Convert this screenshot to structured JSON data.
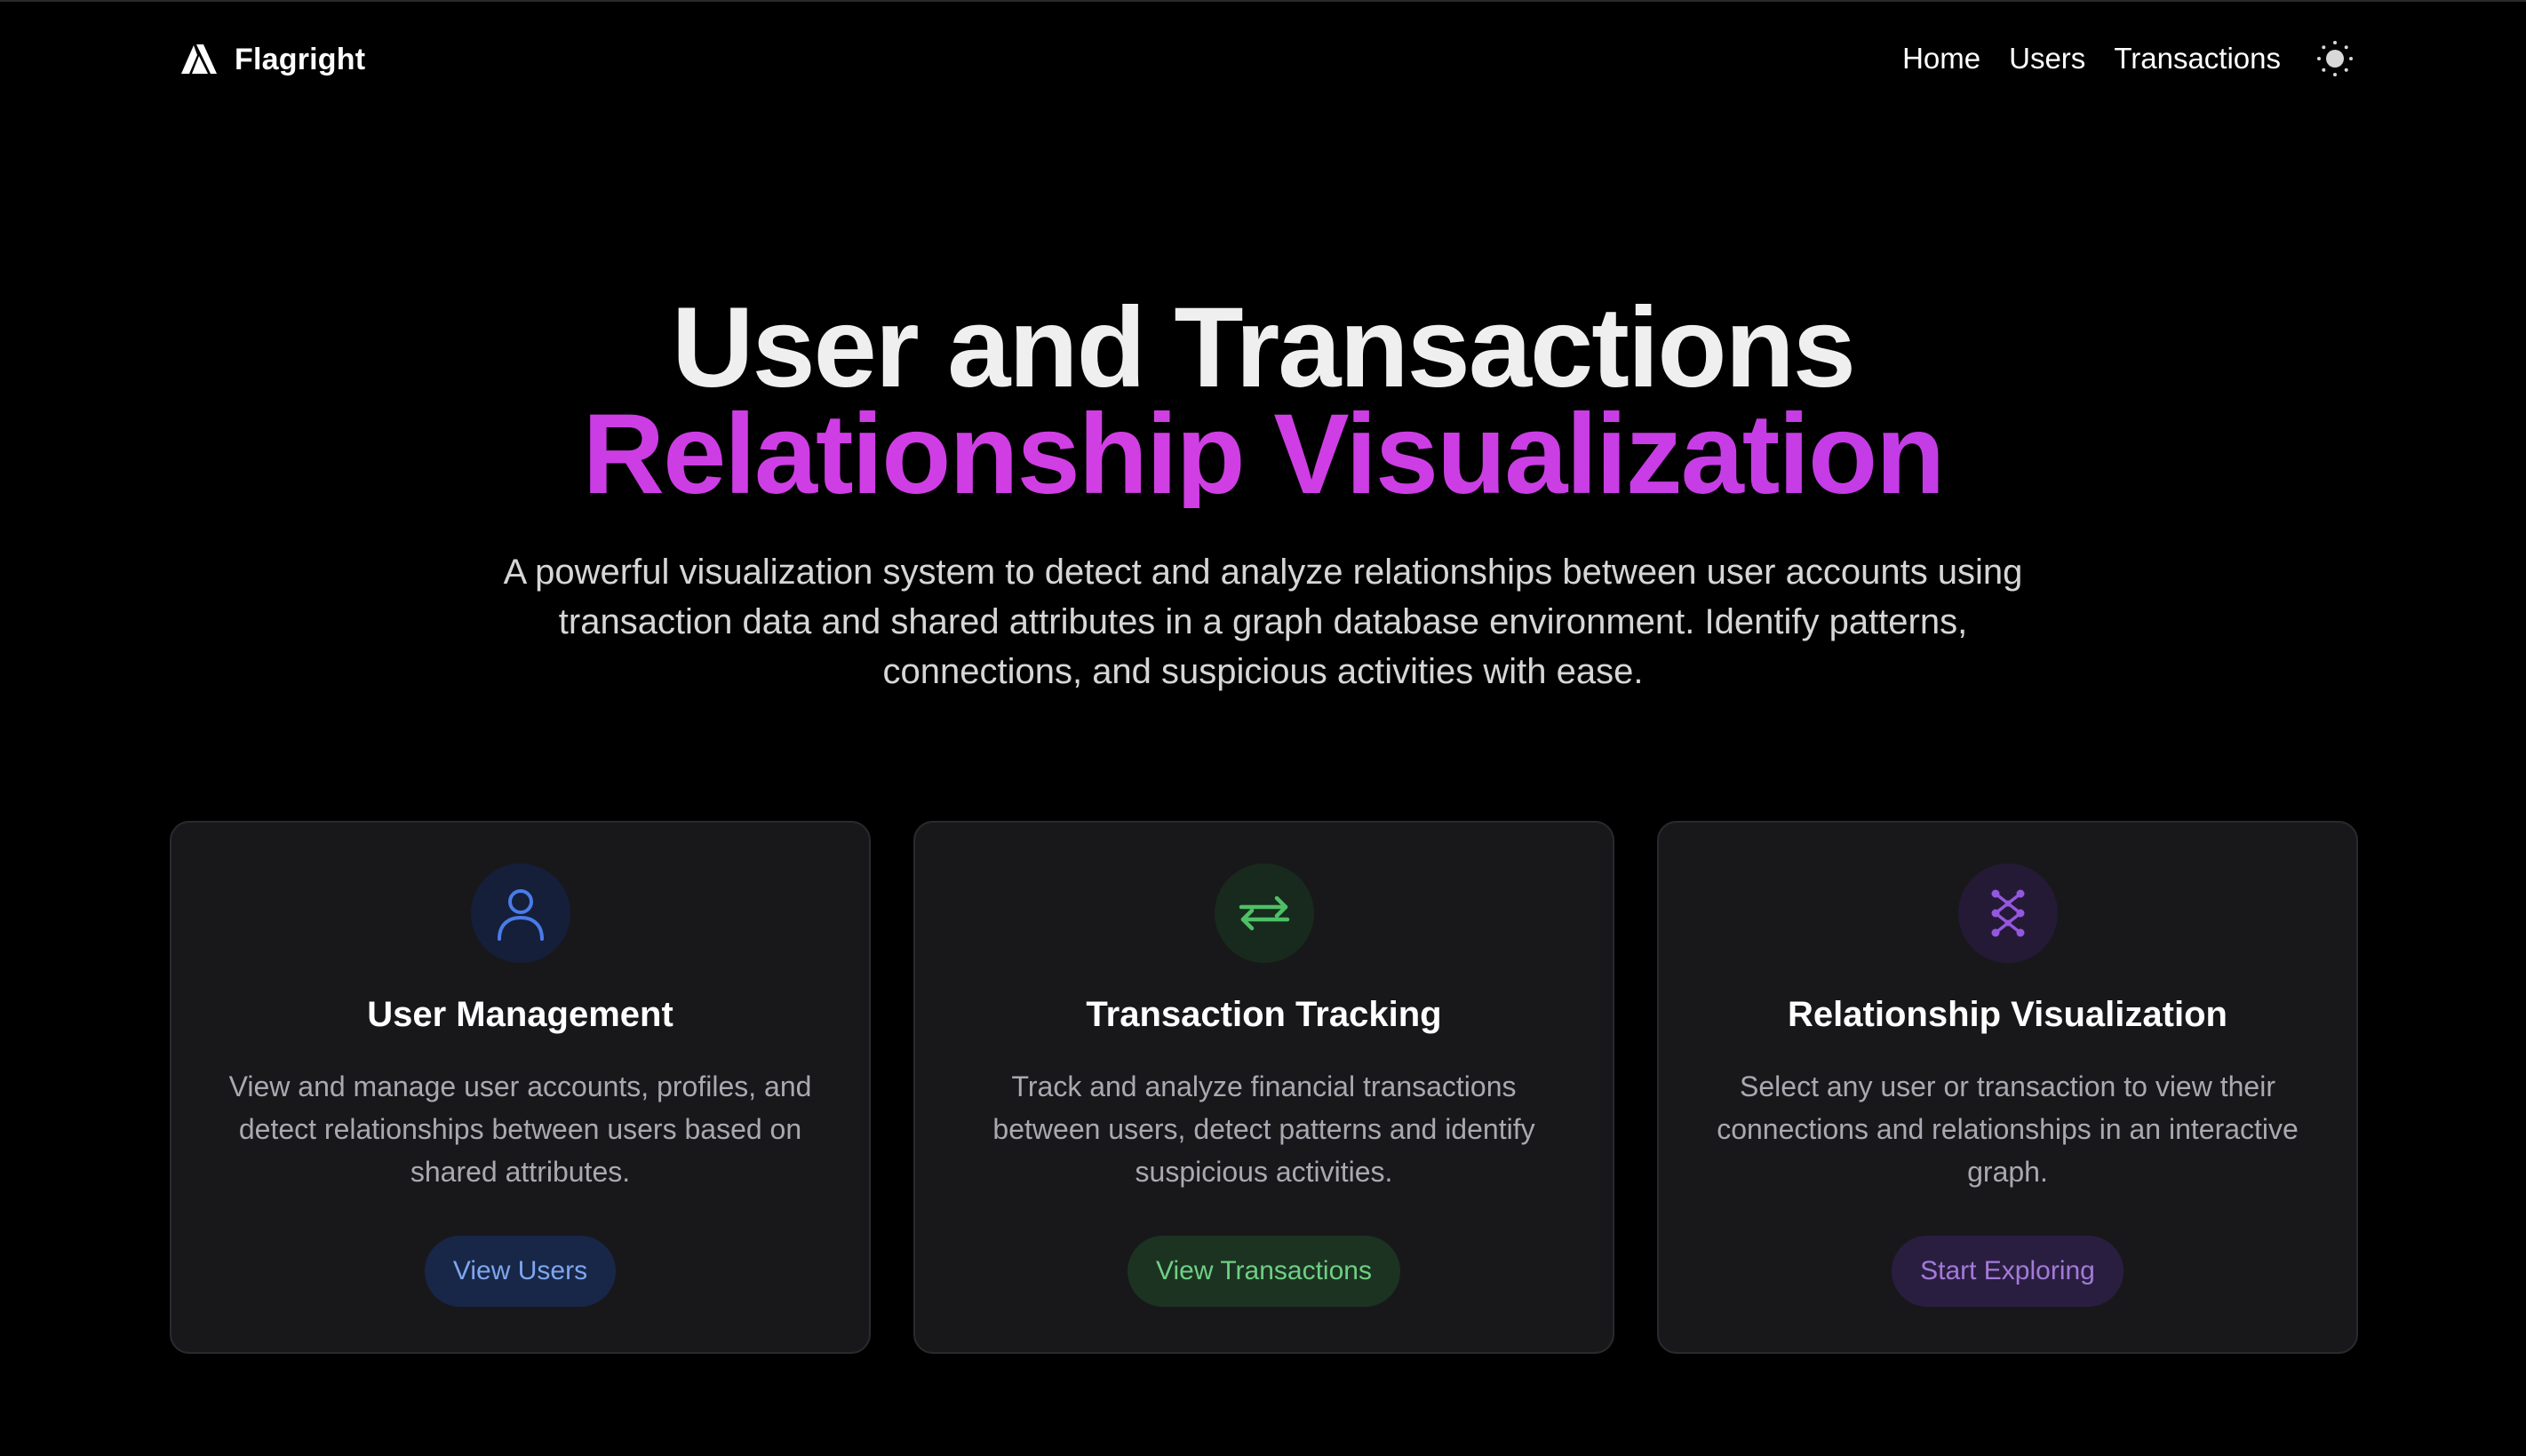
{
  "header": {
    "brand_name": "Flagright",
    "nav": {
      "home": "Home",
      "users": "Users",
      "transactions": "Transactions"
    },
    "theme_icon": "sun-icon"
  },
  "hero": {
    "title_line1": "User and Transactions",
    "title_line2": "Relationship Visualization",
    "description": "A powerful visualization system to detect and analyze relationships between user accounts using transaction data and shared attributes in a graph database environment. Identify patterns, connections, and suspicious activities with ease."
  },
  "cards": [
    {
      "icon": "user-icon",
      "title": "User Management",
      "description": "View and manage user accounts, profiles, and detect relationships between users based on shared attributes.",
      "button": "View Users",
      "accent": "#4a7be8",
      "icon_bg": "#151f3a",
      "button_bg": "#182747",
      "button_text": "#7ea6ef"
    },
    {
      "icon": "arrows-exchange-icon",
      "title": "Transaction Tracking",
      "description": "Track and analyze financial transactions between users, detect patterns and identify suspicious activities.",
      "button": "View Transactions",
      "accent": "#4fbf66",
      "icon_bg": "#172a1d",
      "button_bg": "#1c3322",
      "button_text": "#6fd084"
    },
    {
      "icon": "network-icon",
      "title": "Relationship Visualization",
      "description": "Select any user or transaction to view their connections and relationships in an interactive graph.",
      "button": "Start Exploring",
      "accent": "#9457e0",
      "icon_bg": "#241a36",
      "button_bg": "#2a1e40",
      "button_text": "#a37ad9"
    }
  ],
  "colors": {
    "background": "#000000",
    "card_background": "#18181b",
    "card_border": "#2a2a2e",
    "title_gradient_start": "#c53be6",
    "title_gradient_end": "#b93ae8"
  }
}
